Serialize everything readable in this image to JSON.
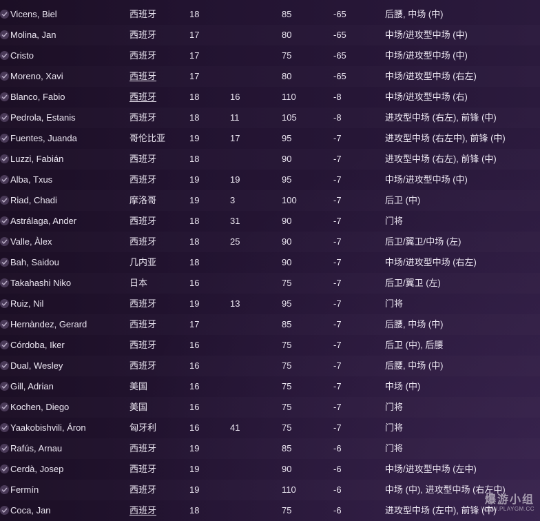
{
  "rows": [
    {
      "name": "Vicens, Biel",
      "nationality": "西班牙",
      "nat_underline": false,
      "age": "18",
      "number": "",
      "value": "85",
      "change": "-65",
      "position": "后腰, 中场 (中)"
    },
    {
      "name": "Molina, Jan",
      "nationality": "西班牙",
      "nat_underline": false,
      "age": "17",
      "number": "",
      "value": "80",
      "change": "-65",
      "position": "中场/进攻型中场 (中)"
    },
    {
      "name": "Cristo",
      "nationality": "西班牙",
      "nat_underline": false,
      "age": "17",
      "number": "",
      "value": "75",
      "change": "-65",
      "position": "中场/进攻型中场 (中)"
    },
    {
      "name": "Moreno, Xavi",
      "nationality": "西班牙",
      "nat_underline": true,
      "age": "17",
      "number": "",
      "value": "80",
      "change": "-65",
      "position": "中场/进攻型中场 (右左)"
    },
    {
      "name": "Blanco, Fabio",
      "nationality": "西班牙",
      "nat_underline": true,
      "age": "18",
      "number": "16",
      "value": "110",
      "change": "-8",
      "position": "中场/进攻型中场 (右)"
    },
    {
      "name": "Pedrola, Estanis",
      "nationality": "西班牙",
      "nat_underline": false,
      "age": "18",
      "number": "11",
      "value": "105",
      "change": "-8",
      "position": "进攻型中场 (右左), 前锋 (中)"
    },
    {
      "name": "Fuentes, Juanda",
      "nationality": "哥伦比亚",
      "nat_underline": false,
      "age": "19",
      "number": "17",
      "value": "95",
      "change": "-7",
      "position": "进攻型中场 (右左中), 前锋 (中)"
    },
    {
      "name": "Luzzi, Fabián",
      "nationality": "西班牙",
      "nat_underline": false,
      "age": "18",
      "number": "",
      "value": "90",
      "change": "-7",
      "position": "进攻型中场 (右左), 前锋 (中)"
    },
    {
      "name": "Alba, Txus",
      "nationality": "西班牙",
      "nat_underline": false,
      "age": "19",
      "number": "19",
      "value": "95",
      "change": "-7",
      "position": "中场/进攻型中场 (中)"
    },
    {
      "name": "Riad, Chadi",
      "nationality": "摩洛哥",
      "nat_underline": false,
      "age": "19",
      "number": "3",
      "value": "100",
      "change": "-7",
      "position": "后卫 (中)"
    },
    {
      "name": "Astrálaga, Ander",
      "nationality": "西班牙",
      "nat_underline": false,
      "age": "18",
      "number": "31",
      "value": "90",
      "change": "-7",
      "position": "门将"
    },
    {
      "name": "Valle, Àlex",
      "nationality": "西班牙",
      "nat_underline": false,
      "age": "18",
      "number": "25",
      "value": "90",
      "change": "-7",
      "position": "后卫/翼卫/中场 (左)"
    },
    {
      "name": "Bah, Saidou",
      "nationality": "几内亚",
      "nat_underline": false,
      "age": "18",
      "number": "",
      "value": "90",
      "change": "-7",
      "position": "中场/进攻型中场 (右左)"
    },
    {
      "name": "Takahashi Niko",
      "nationality": "日本",
      "nat_underline": false,
      "age": "16",
      "number": "",
      "value": "75",
      "change": "-7",
      "position": "后卫/翼卫 (左)"
    },
    {
      "name": "Ruiz, Nil",
      "nationality": "西班牙",
      "nat_underline": false,
      "age": "19",
      "number": "13",
      "value": "95",
      "change": "-7",
      "position": "门将"
    },
    {
      "name": "Hernàndez, Gerard",
      "nationality": "西班牙",
      "nat_underline": false,
      "age": "17",
      "number": "",
      "value": "85",
      "change": "-7",
      "position": "后腰, 中场 (中)"
    },
    {
      "name": "Córdoba, Iker",
      "nationality": "西班牙",
      "nat_underline": false,
      "age": "16",
      "number": "",
      "value": "75",
      "change": "-7",
      "position": "后卫 (中), 后腰"
    },
    {
      "name": "Dual, Wesley",
      "nationality": "西班牙",
      "nat_underline": false,
      "age": "16",
      "number": "",
      "value": "75",
      "change": "-7",
      "position": "后腰, 中场 (中)"
    },
    {
      "name": "Gill, Adrian",
      "nationality": "美国",
      "nat_underline": false,
      "age": "16",
      "number": "",
      "value": "75",
      "change": "-7",
      "position": "中场 (中)"
    },
    {
      "name": "Kochen, Diego",
      "nationality": "美国",
      "nat_underline": false,
      "age": "16",
      "number": "",
      "value": "75",
      "change": "-7",
      "position": "门将"
    },
    {
      "name": "Yaakobishvili, Áron",
      "nationality": "匈牙利",
      "nat_underline": false,
      "age": "16",
      "number": "41",
      "value": "75",
      "change": "-7",
      "position": "门将"
    },
    {
      "name": "Rafús, Arnau",
      "nationality": "西班牙",
      "nat_underline": false,
      "age": "19",
      "number": "",
      "value": "85",
      "change": "-6",
      "position": "门将"
    },
    {
      "name": "Cerdà, Josep",
      "nationality": "西班牙",
      "nat_underline": false,
      "age": "19",
      "number": "",
      "value": "90",
      "change": "-6",
      "position": "中场/进攻型中场 (左中)"
    },
    {
      "name": "Fermín",
      "nationality": "西班牙",
      "nat_underline": false,
      "age": "19",
      "number": "",
      "value": "110",
      "change": "-6",
      "position": "中场 (中), 进攻型中场 (右左中)"
    },
    {
      "name": "Coca, Jan",
      "nationality": "西班牙",
      "nat_underline": true,
      "age": "18",
      "number": "",
      "value": "75",
      "change": "-6",
      "position": "进攻型中场 (左中), 前锋 (中)"
    }
  ],
  "watermark": {
    "title": "爆游小组",
    "url": "WWW.PLAYGM.CC"
  },
  "colors": {
    "text": "#ece7f2",
    "check_bg": "#4a3a58",
    "check_mark": "#b9adc6"
  }
}
